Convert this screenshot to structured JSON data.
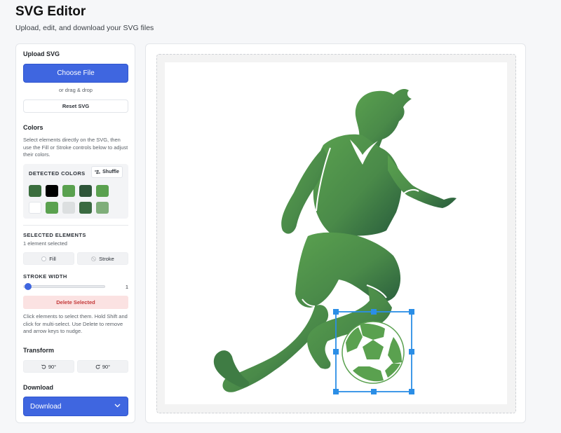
{
  "header": {
    "title": "SVG Editor",
    "subtitle": "Upload, edit, and download your SVG files"
  },
  "sidebar": {
    "upload": {
      "title": "Upload SVG",
      "choose_label": "Choose File",
      "drag_text": "or drag & drop",
      "reset_label": "Reset SVG"
    },
    "colors": {
      "title": "Colors",
      "help": "Select elements directly on the SVG, then use the Fill or Stroke controls below to adjust their colors.",
      "detected_label": "DETECTED COLORS",
      "shuffle_label": "Shuffle",
      "swatches": [
        "#3b6e3e",
        "#000000",
        "#5aa14f",
        "#2e5539",
        "#5aa14f",
        "#ffffff",
        "#5aa14f",
        "#dcdfe0",
        "#3a6a41",
        "#7fae7a"
      ]
    },
    "selection": {
      "title": "SELECTED ELEMENTS",
      "count": "1 element selected",
      "fill_label": "Fill",
      "stroke_label": "Stroke",
      "stroke_width_label": "STROKE WIDTH",
      "stroke_width_value": "1",
      "delete_label": "Delete Selected",
      "help": "Click elements to select them. Hold Shift and click for multi-select. Use Delete to remove and arrow keys to nudge."
    },
    "transform": {
      "title": "Transform",
      "rotate_ccw_label": "90°",
      "rotate_cw_label": "90°"
    },
    "download": {
      "title": "Download",
      "button_label": "Download"
    }
  },
  "colors": {
    "accent": "#3f66e0",
    "selection": "#2b8ee6",
    "player_light": "#5aa14f",
    "player_dark": "#285c3c"
  }
}
